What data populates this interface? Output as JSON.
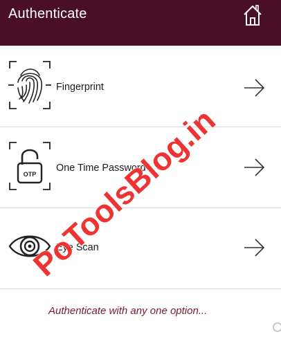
{
  "header": {
    "title": "Authenticate",
    "home_icon": "home-icon"
  },
  "options": [
    {
      "label": "Fingerprint",
      "icon": "fingerprint-icon"
    },
    {
      "label": "One Time Password",
      "icon": "otp-lock-icon",
      "icon_text": "OTP"
    },
    {
      "label": "Eye Scan",
      "icon": "eye-scan-icon"
    }
  ],
  "footer": {
    "hint": "Authenticate with any one option..."
  },
  "watermark": {
    "text": "PoToolsBlog.in",
    "color": "#ee3333"
  },
  "colors": {
    "header_bg": "#4a0f26",
    "hint_text": "#7b1a2d",
    "divider": "#d9d9d9"
  }
}
